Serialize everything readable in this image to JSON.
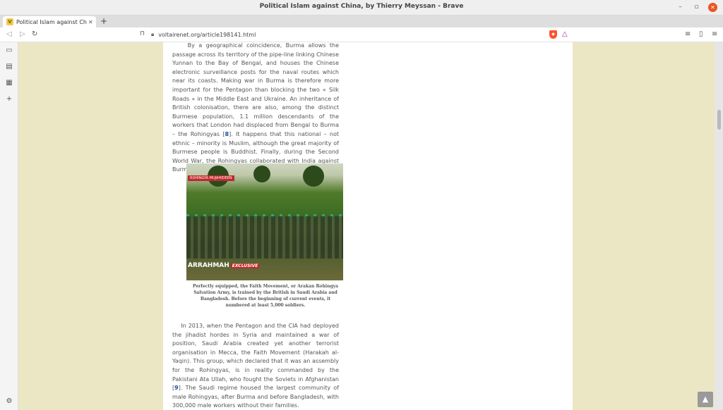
{
  "window": {
    "title": "Political Islam against China, by Thierry Meyssan - Brave"
  },
  "tabs": [
    {
      "title": "Political Islam against Chi",
      "favicon": "V"
    }
  ],
  "toolbar": {
    "url": "voltairenet.org/article198141.html"
  },
  "article": {
    "para1_a": "By a geographical coincidence, Burma allows the passage across its territory of the pipe-line linking Chinese Yunnan to the Bay of Bengal, and houses the Chinese electronic surveillance posts for the naval routes which near its coasts. Making war in Burma is therefore more important for the Pentagon than blocking the two « Silk Roads » in the Middle East and Ukraine. An inheritance of British colonisation, there are also, among the distinct Burmese population, 1.1 million descendants of the workers that London had displaced from Bengal to Burma – the Rohingyas [",
    "para1_ref": "8",
    "para1_b": "]. It happens that this national – not ethnic – minority is Muslim, although the great majority of Burmese people is Buddhist. Finally, during the Second World War, the Rohingyas collaborated with India against Burmese nationalists.",
    "photo_tag": "ROHINGYA MUJAHIDEEN",
    "photo_brand": "ARRAHMAH",
    "photo_exclusive": "EXCLUSIVE",
    "caption": "Perfectly equipped, the Faith Movement, or Arakan Rohingya Salvation Army, is trained by the British in Saudi Arabia and Bangladesh. Before the beginning of current events, it numbered at least 5,000 soldiers.",
    "para2_a": "In 2013, when the Pentagon and the CIA had deployed the jihadist hordes in Syria and maintained a war of position, Saudi Arabia created yet another terrorist organisation in Mecca, the Faith Movement (Harakah al-Yaqin). This group, which declared that it was an assembly for the Rohingyas, is in reality commanded by the Pakistani Ata Ullah, who fought the Soviets in Afghanistan [",
    "para2_ref": "9",
    "para2_b": "]. The Saudi regime housed the largest community of male Rohingyas, after Burma and before Bangladesh, with 300,000 male workers without their families."
  },
  "colors": {
    "page_background": "#ebe6c4",
    "link": "#1a4fa0",
    "brave_orange": "#fb542b"
  }
}
